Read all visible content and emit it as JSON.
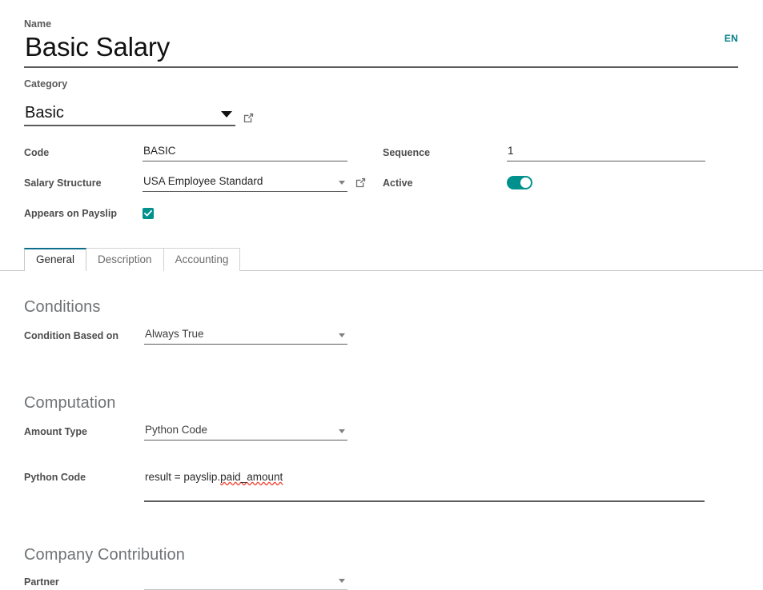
{
  "header": {
    "name_label": "Name",
    "name_value": "Basic Salary",
    "lang_badge": "EN",
    "category_label": "Category",
    "category_value": "Basic",
    "category_open_icon": "external-link-icon",
    "category_caret_icon": "chevron-down-icon"
  },
  "fields": {
    "code_label": "Code",
    "code_value": "BASIC",
    "sequence_label": "Sequence",
    "sequence_value": "1",
    "salary_structure_label": "Salary Structure",
    "salary_structure_value": "USA Employee Standard",
    "salary_structure_open_icon": "external-link-icon",
    "active_label": "Active",
    "active_value": true,
    "appears_on_payslip_label": "Appears on Payslip",
    "appears_on_payslip_value": true
  },
  "tabs": [
    {
      "label": "General",
      "active": true
    },
    {
      "label": "Description",
      "active": false
    },
    {
      "label": "Accounting",
      "active": false
    }
  ],
  "conditions": {
    "title": "Conditions",
    "condition_based_on_label": "Condition Based on",
    "condition_based_on_value": "Always True"
  },
  "computation": {
    "title": "Computation",
    "amount_type_label": "Amount Type",
    "amount_type_value": "Python Code",
    "python_code_label": "Python Code",
    "python_code_prefix": "result = payslip.",
    "python_code_misspelled": "paid_amount"
  },
  "company_contribution": {
    "title": "Company Contribution",
    "partner_label": "Partner",
    "partner_value": ""
  },
  "colors": {
    "accent_teal": "#00918f",
    "link_teal": "#017e84",
    "active_tab_border": "#0d6e8c",
    "spellcheck_red": "#ef4a3a",
    "text_dark": "#262626",
    "label_grey": "#4d4d4d",
    "section_grey": "#6f7376"
  }
}
